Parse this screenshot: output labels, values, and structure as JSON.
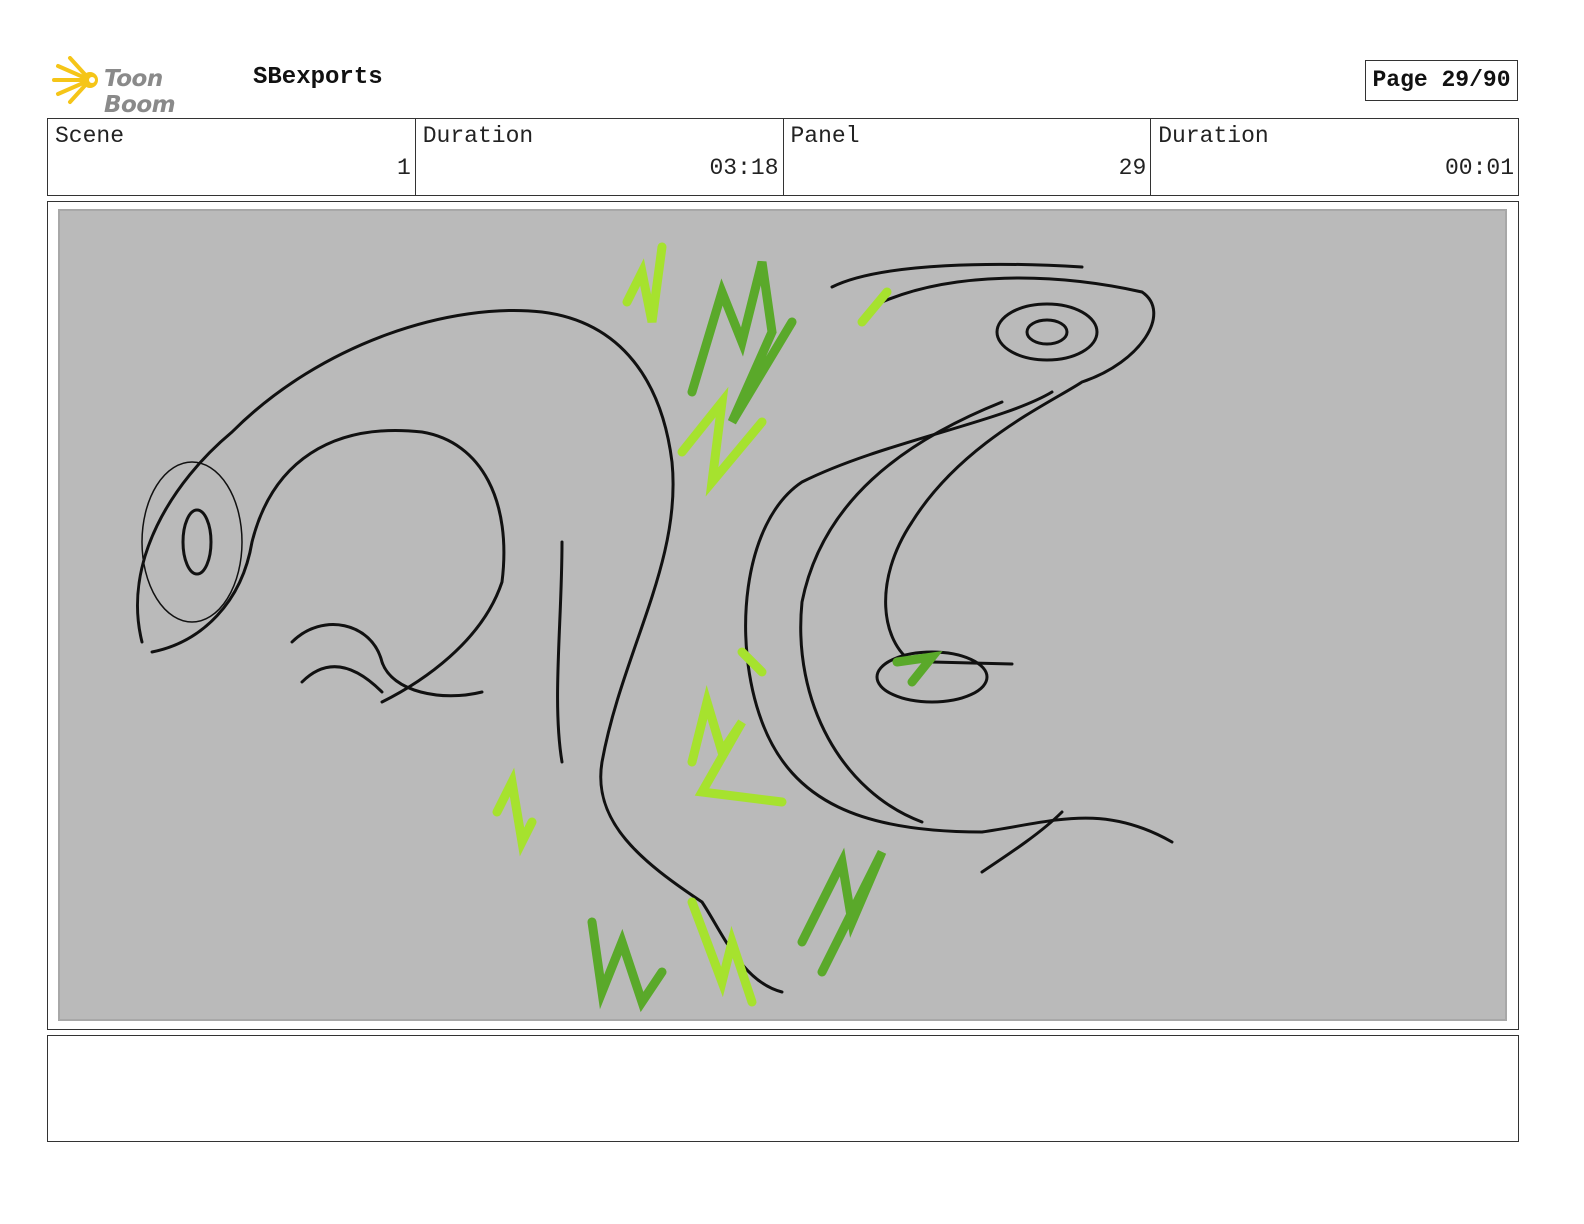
{
  "header": {
    "logo_text": "Toon Boom",
    "project": "SBexports",
    "page_label": "Page 29/90"
  },
  "info": [
    {
      "label": "Scene",
      "value": "1"
    },
    {
      "label": "Duration",
      "value": "03:18"
    },
    {
      "label": "Panel",
      "value": "29"
    },
    {
      "label": "Duration",
      "value": "00:01"
    }
  ],
  "colors": {
    "sketch_bg": "#bababa",
    "line": "#111111",
    "green_light": "#a6e22e",
    "green_dark": "#5aa92a"
  },
  "notes": ""
}
